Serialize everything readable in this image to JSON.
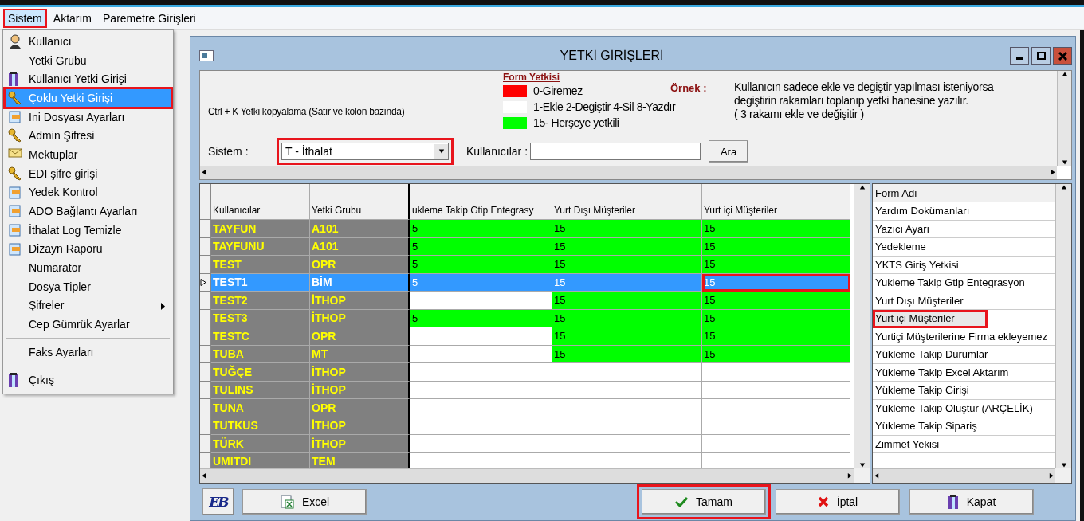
{
  "menu_bar": [
    {
      "label": "Sistem",
      "selected": true,
      "annotated": true
    },
    {
      "label": "Aktarım",
      "selected": false,
      "annotated": false
    },
    {
      "label": "Paremetre Girişleri",
      "selected": false,
      "annotated": false
    }
  ],
  "sistem_menu": [
    {
      "kind": "item",
      "label": "Kullanıcı",
      "icon": true,
      "selected": false,
      "submenu": false,
      "annotated": false
    },
    {
      "kind": "item",
      "label": "Yetki Grubu",
      "icon": false,
      "selected": false,
      "submenu": false,
      "annotated": false
    },
    {
      "kind": "item",
      "label": "Kullanıcı Yetki Girişi",
      "icon": true,
      "selected": false,
      "submenu": false,
      "annotated": false
    },
    {
      "kind": "item",
      "label": "Çoklu Yetki Girişi",
      "icon": true,
      "selected": true,
      "submenu": false,
      "annotated": true
    },
    {
      "kind": "item",
      "label": "Ini Dosyası  Ayarları",
      "icon": true,
      "selected": false,
      "submenu": false,
      "annotated": false
    },
    {
      "kind": "item",
      "label": "Admin Şifresi",
      "icon": true,
      "selected": false,
      "submenu": false,
      "annotated": false
    },
    {
      "kind": "item",
      "label": "Mektuplar",
      "icon": true,
      "selected": false,
      "submenu": false,
      "annotated": false
    },
    {
      "kind": "item",
      "label": "EDI şifre girişi",
      "icon": true,
      "selected": false,
      "submenu": false,
      "annotated": false
    },
    {
      "kind": "item",
      "label": "Yedek Kontrol",
      "icon": true,
      "selected": false,
      "submenu": false,
      "annotated": false
    },
    {
      "kind": "item",
      "label": "ADO Bağlantı Ayarları",
      "icon": true,
      "selected": false,
      "submenu": false,
      "annotated": false
    },
    {
      "kind": "item",
      "label": "İthalat Log Temizle",
      "icon": true,
      "selected": false,
      "submenu": false,
      "annotated": false
    },
    {
      "kind": "item",
      "label": "Dizayn Raporu",
      "icon": true,
      "selected": false,
      "submenu": false,
      "annotated": false
    },
    {
      "kind": "item",
      "label": "Numarator",
      "icon": false,
      "selected": false,
      "submenu": false,
      "annotated": false
    },
    {
      "kind": "item",
      "label": "Dosya Tipler",
      "icon": false,
      "selected": false,
      "submenu": false,
      "annotated": false
    },
    {
      "kind": "item",
      "label": "Şifreler",
      "icon": false,
      "selected": false,
      "submenu": true,
      "annotated": false
    },
    {
      "kind": "item",
      "label": "Cep Gümrük Ayarlar",
      "icon": false,
      "selected": false,
      "submenu": false,
      "annotated": false
    },
    {
      "kind": "separator"
    },
    {
      "kind": "item",
      "label": "Faks Ayarları",
      "icon": false,
      "selected": false,
      "submenu": false,
      "annotated": false
    },
    {
      "kind": "separator"
    },
    {
      "kind": "item",
      "label": "Çıkış",
      "icon": true,
      "selected": false,
      "submenu": false,
      "annotated": false
    }
  ],
  "window": {
    "title": "YETKİ GİRİŞLERİ"
  },
  "info": {
    "shortcut_note": "Ctrl + K Yetki kopyalama (Satır ve kolon bazında)",
    "legend_title": "Form Yetkisi",
    "legend": [
      {
        "label": "0-Giremez",
        "color": "#ff0000"
      },
      {
        "label": "1-Ekle  2-Degiştir  4-Sil  8-Yazdır",
        "color": "#ffffff"
      },
      {
        "label": "15- Herşeye yetkili",
        "color": "#00ff00"
      }
    ],
    "example_label": "Örnek :",
    "example_lines": [
      "Kullanıcın sadece ekle ve degiştir yapılması isteniyorsa",
      "degiştirin rakamları toplanıp yetki hanesine yazılır.",
      "( 3 rakamı ekle ve değişitir )"
    ]
  },
  "filters": {
    "system_label": "Sistem :",
    "system_value": "T - İthalat",
    "system_annotated": true,
    "users_label": "Kullanıcılar :",
    "search_button": "Ara"
  },
  "grid": {
    "columns": [
      "Kullanıcılar",
      "Yetki Grubu",
      "ukleme Takip Gtip Entegrasy",
      "Yurt Dışı Müşteriler",
      "Yurt içi Müşteriler"
    ],
    "rows": [
      {
        "cells": [
          {
            "kind": "name",
            "value": "TAYFUN"
          },
          {
            "kind": "name",
            "value": "A101"
          },
          {
            "kind": "permission",
            "filled": true,
            "value": "5",
            "annotated": false
          },
          {
            "kind": "permission",
            "filled": true,
            "value": "15",
            "annotated": false
          },
          {
            "kind": "permission",
            "filled": true,
            "value": "15",
            "annotated": false
          }
        ],
        "selected": false
      },
      {
        "cells": [
          {
            "kind": "name",
            "value": "TAYFUNU"
          },
          {
            "kind": "name",
            "value": "A101"
          },
          {
            "kind": "permission",
            "filled": true,
            "value": "5",
            "annotated": false
          },
          {
            "kind": "permission",
            "filled": true,
            "value": "15",
            "annotated": false
          },
          {
            "kind": "permission",
            "filled": true,
            "value": "15",
            "annotated": false
          }
        ],
        "selected": false
      },
      {
        "cells": [
          {
            "kind": "name",
            "value": "TEST"
          },
          {
            "kind": "name",
            "value": "OPR"
          },
          {
            "kind": "permission",
            "filled": true,
            "value": "5",
            "annotated": false
          },
          {
            "kind": "permission",
            "filled": true,
            "value": "15",
            "annotated": false
          },
          {
            "kind": "permission",
            "filled": true,
            "value": "15",
            "annotated": false
          }
        ],
        "selected": false
      },
      {
        "cells": [
          {
            "kind": "name",
            "value": "TEST1"
          },
          {
            "kind": "name",
            "value": "BİM"
          },
          {
            "kind": "permission",
            "filled": true,
            "value": "5",
            "annotated": false
          },
          {
            "kind": "permission",
            "filled": true,
            "value": "15",
            "annotated": false
          },
          {
            "kind": "permission",
            "filled": true,
            "value": "15",
            "annotated": true
          }
        ],
        "selected": true
      },
      {
        "cells": [
          {
            "kind": "name",
            "value": "TEST2"
          },
          {
            "kind": "name",
            "value": "İTHOP"
          },
          {
            "kind": "permission",
            "filled": false,
            "annotated": false
          },
          {
            "kind": "permission",
            "filled": true,
            "value": "15",
            "annotated": false
          },
          {
            "kind": "permission",
            "filled": true,
            "value": "15",
            "annotated": false
          }
        ],
        "selected": false
      },
      {
        "cells": [
          {
            "kind": "name",
            "value": "TEST3"
          },
          {
            "kind": "name",
            "value": "İTHOP"
          },
          {
            "kind": "permission",
            "filled": true,
            "value": "5",
            "annotated": false
          },
          {
            "kind": "permission",
            "filled": true,
            "value": "15",
            "annotated": false
          },
          {
            "kind": "permission",
            "filled": true,
            "value": "15",
            "annotated": false
          }
        ],
        "selected": false
      },
      {
        "cells": [
          {
            "kind": "name",
            "value": "TESTC"
          },
          {
            "kind": "name",
            "value": "OPR"
          },
          {
            "kind": "permission",
            "filled": false,
            "annotated": false
          },
          {
            "kind": "permission",
            "filled": true,
            "value": "15",
            "annotated": false
          },
          {
            "kind": "permission",
            "filled": true,
            "value": "15",
            "annotated": false
          }
        ],
        "selected": false
      },
      {
        "cells": [
          {
            "kind": "name",
            "value": "TUBA"
          },
          {
            "kind": "name",
            "value": "MT"
          },
          {
            "kind": "permission",
            "filled": false,
            "annotated": false
          },
          {
            "kind": "permission",
            "filled": true,
            "value": "15",
            "annotated": false
          },
          {
            "kind": "permission",
            "filled": true,
            "value": "15",
            "annotated": false
          }
        ],
        "selected": false
      },
      {
        "cells": [
          {
            "kind": "name",
            "value": "TUĞÇE"
          },
          {
            "kind": "name",
            "value": "İTHOP"
          },
          {
            "kind": "permission",
            "filled": false,
            "annotated": false
          },
          {
            "kind": "permission",
            "filled": false,
            "annotated": false
          },
          {
            "kind": "permission",
            "filled": false,
            "annotated": false
          }
        ],
        "selected": false
      },
      {
        "cells": [
          {
            "kind": "name",
            "value": "TULINS"
          },
          {
            "kind": "name",
            "value": "İTHOP"
          },
          {
            "kind": "permission",
            "filled": false,
            "annotated": false
          },
          {
            "kind": "permission",
            "filled": false,
            "annotated": false
          },
          {
            "kind": "permission",
            "filled": false,
            "annotated": false
          }
        ],
        "selected": false
      },
      {
        "cells": [
          {
            "kind": "name",
            "value": "TUNA"
          },
          {
            "kind": "name",
            "value": "OPR"
          },
          {
            "kind": "permission",
            "filled": false,
            "annotated": false
          },
          {
            "kind": "permission",
            "filled": false,
            "annotated": false
          },
          {
            "kind": "permission",
            "filled": false,
            "annotated": false
          }
        ],
        "selected": false
      },
      {
        "cells": [
          {
            "kind": "name",
            "value": "TUTKUS"
          },
          {
            "kind": "name",
            "value": "İTHOP"
          },
          {
            "kind": "permission",
            "filled": false,
            "annotated": false
          },
          {
            "kind": "permission",
            "filled": false,
            "annotated": false
          },
          {
            "kind": "permission",
            "filled": false,
            "annotated": false
          }
        ],
        "selected": false
      },
      {
        "cells": [
          {
            "kind": "name",
            "value": "TÜRK"
          },
          {
            "kind": "name",
            "value": "İTHOP"
          },
          {
            "kind": "permission",
            "filled": false,
            "annotated": false
          },
          {
            "kind": "permission",
            "filled": false,
            "annotated": false
          },
          {
            "kind": "permission",
            "filled": false,
            "annotated": false
          }
        ],
        "selected": false
      },
      {
        "cells": [
          {
            "kind": "name",
            "value": "UMITDI"
          },
          {
            "kind": "name",
            "value": "TEM"
          },
          {
            "kind": "permission",
            "filled": false,
            "annotated": false
          },
          {
            "kind": "permission",
            "filled": false,
            "annotated": false
          },
          {
            "kind": "permission",
            "filled": false,
            "annotated": false
          }
        ],
        "selected": false
      }
    ]
  },
  "form_list": {
    "header": "Form Adı",
    "items": [
      {
        "label": "Yardım Dokümanları",
        "selected": false,
        "annotated": false
      },
      {
        "label": "Yazıcı Ayarı",
        "selected": false,
        "annotated": false
      },
      {
        "label": "Yedekleme",
        "selected": false,
        "annotated": false
      },
      {
        "label": "YKTS Giriş Yetkisi",
        "selected": false,
        "annotated": false
      },
      {
        "label": "Yukleme Takip Gtip Entegrasyon",
        "selected": false,
        "annotated": false
      },
      {
        "label": "Yurt Dışı Müşteriler",
        "selected": false,
        "annotated": false
      },
      {
        "label": "Yurt içi Müşteriler",
        "selected": true,
        "annotated": true
      },
      {
        "label": "Yurtiçi Müşterilerine Firma ekleyemez",
        "selected": false,
        "annotated": false
      },
      {
        "label": "Yükleme Takip Durumlar",
        "selected": false,
        "annotated": false
      },
      {
        "label": "Yükleme Takip Excel Aktarım",
        "selected": false,
        "annotated": false
      },
      {
        "label": "Yükleme Takip Girişi",
        "selected": false,
        "annotated": false
      },
      {
        "label": "Yükleme Takip Oluştur (ARÇELİK)",
        "selected": false,
        "annotated": false
      },
      {
        "label": "Yükleme Takip Sipariş",
        "selected": false,
        "annotated": false
      },
      {
        "label": "Zimmet Yekisi",
        "selected": false,
        "annotated": false
      }
    ]
  },
  "buttons": [
    {
      "kind": "logo",
      "label": "EB"
    },
    {
      "kind": "excel",
      "label": "Excel"
    },
    {
      "kind": "ok",
      "label": "Tamam",
      "annotated": true
    },
    {
      "kind": "cancel",
      "label": "İptal"
    },
    {
      "kind": "close",
      "label": "Kapat"
    }
  ]
}
